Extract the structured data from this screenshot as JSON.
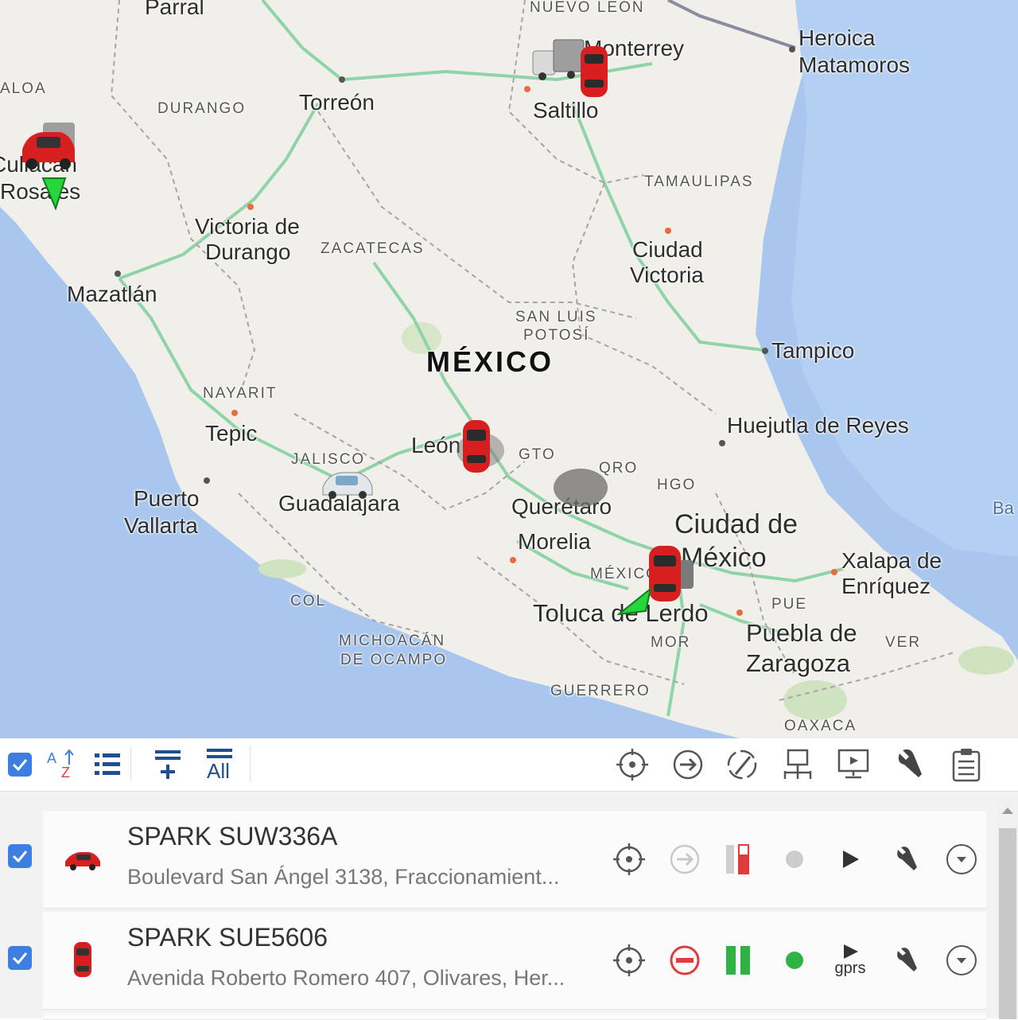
{
  "map": {
    "country": "MÉXICO",
    "cities": [
      "Parral",
      "Monterrey",
      "Heroica",
      "Matamoros",
      "Torreón",
      "Saltillo",
      "Culiacán",
      "Rosales",
      "Victoria de",
      "Durango",
      "Mazatlán",
      "Ciudad",
      "Victoria",
      "Tampico",
      "Huejutla de Reyes",
      "Tepic",
      "León",
      "Puerto",
      "Vallarta",
      "Guadalajara",
      "Querétaro",
      "Morelia",
      "Ciudad de",
      "México",
      "Xalapa de",
      "Enríquez",
      "Toluca de Lerdo",
      "Puebla de",
      "Zaragoza",
      "Ba"
    ],
    "states": [
      "NUEVO LEÓN",
      "ALOA",
      "DURANGO",
      "TAMAULIPAS",
      "ZACATECAS",
      "SAN LUIS",
      "POTOSÍ",
      "NAYARIT",
      "JALISCO",
      "GTO",
      "QRO",
      "HGO",
      "MÉXICO",
      "COL",
      "PUE",
      "MICHOACÁN",
      "DE OCAMPO",
      "MOR",
      "VER",
      "GUERRERO",
      "OAXACA"
    ],
    "colors": {
      "water": "#a8c6ee",
      "land": "#f1efe9",
      "highway": "#8fd3a8"
    }
  },
  "toolbar": {
    "select_all_checked": true,
    "all_label": "All",
    "icons": [
      "sort-az-icon",
      "list-icon",
      "add-group-icon",
      "all-groups-icon",
      "locate-icon",
      "follow-icon",
      "track-icon",
      "network-icon",
      "monitor-icon",
      "wrench-icon",
      "clipboard-icon"
    ]
  },
  "vehicles": [
    {
      "checked": true,
      "name": "SPARK SUW336A",
      "address": "Boulevard San Ángel 3138, Fraccionamient...",
      "icon": "red-car-side-icon",
      "follow_active": false,
      "signal": "low",
      "status_color": "#cccccc",
      "action_icon": "play-icon",
      "action_label": ""
    },
    {
      "checked": true,
      "name": "SPARK SUE5606",
      "address": "Avenida Roberto Romero 407, Olivares, Her...",
      "icon": "red-car-top-icon",
      "follow_active": true,
      "signal": "high",
      "status_color": "#2fb344",
      "action_icon": "gprs-icon",
      "action_label": "gprs"
    }
  ]
}
